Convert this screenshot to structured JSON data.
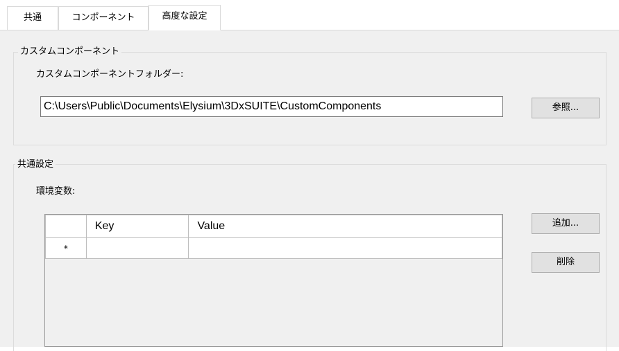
{
  "tabs": [
    {
      "label": "共通"
    },
    {
      "label": "コンポーネント"
    },
    {
      "label": "高度な設定"
    }
  ],
  "custom_group": {
    "title": "カスタムコンポーネント",
    "folder_label": "カスタムコンポーネントフォルダー:",
    "folder_value": "C:\\Users\\Public\\Documents\\Elysium\\3DxSUITE\\CustomComponents",
    "browse_label": "参照..."
  },
  "common_group": {
    "title": "共通設定",
    "env_label": "環境変数:",
    "columns": [
      "",
      "Key",
      "Value"
    ],
    "new_row_marker": "*",
    "add_label": "追加...",
    "delete_label": "削除"
  }
}
